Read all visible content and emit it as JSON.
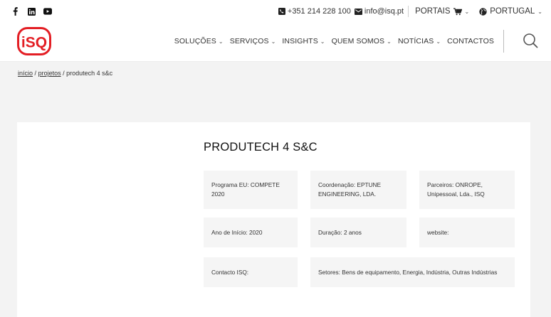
{
  "topbar": {
    "social": [
      {
        "icon": "facebook-icon"
      },
      {
        "icon": "linkedin-icon"
      },
      {
        "icon": "youtube-icon"
      }
    ],
    "phone_icon": "phone-icon",
    "phone": "+351 214 228 100",
    "email_icon": "mail-icon",
    "email": "info@isq.pt",
    "portais_label": "PORTAIS",
    "country_label": "PORTUGAL"
  },
  "header": {
    "logo_text": "iSQ",
    "brand_color": "#e31e24",
    "nav": [
      {
        "label": "SOLUÇÕES"
      },
      {
        "label": "SERVIÇOS"
      },
      {
        "label": "INSIGHTS"
      },
      {
        "label": "QUEM SOMOS"
      },
      {
        "label": "NOTÍCIAS"
      },
      {
        "label": "CONTACTOS"
      }
    ],
    "search_icon": "search-icon"
  },
  "breadcrumb": {
    "home": "início",
    "projects": "projetos",
    "current": "produtech 4 s&c",
    "separator": "/"
  },
  "project": {
    "title": "PRODUTECH 4 S&C",
    "programa": "Programa EU: COMPETE 2020",
    "coordenacao": "Coordenação: EPTUNE ENGINEERING, LDA.",
    "parceiros": "Parceiros: ONROPE, Unipessoal, Lda., ISQ",
    "ano": "Ano de Início:  2020",
    "duracao": "Duração: 2 anos",
    "website": "website:",
    "contacto": "Contacto ISQ:",
    "setores": "Setores: Bens de equipamento, Energia, Indústria, Outras Indústrias"
  }
}
